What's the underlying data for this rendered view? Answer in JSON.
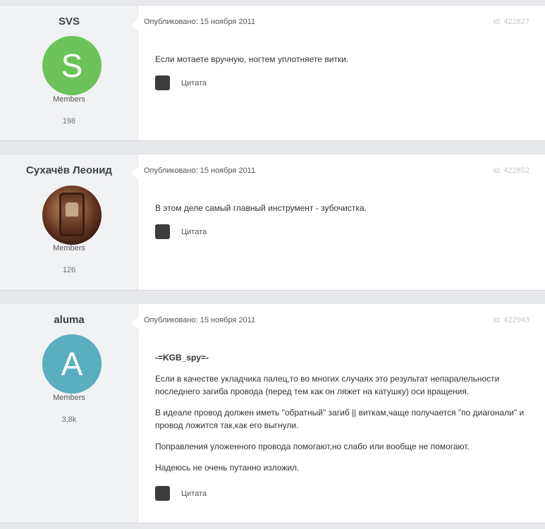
{
  "posts": [
    {
      "author": "SVS",
      "avatar_letter": "S",
      "avatar_color": "#6cc35a",
      "role": "Members",
      "count": "198",
      "published": "Опубликовано: 15 ноября 2011",
      "id_label": "id: 422827",
      "paragraphs": [
        "Если мотаете вручную, ногтем уплотняете витки."
      ],
      "quote_label": "Цитата"
    },
    {
      "author": "Сухачёв Леонид",
      "avatar_letter": "",
      "avatar_color": "#6b3a26",
      "role": "Members",
      "count": "126",
      "published": "Опубликовано: 15 ноября 2011",
      "id_label": "id: 422852",
      "paragraphs": [
        "В этом деле самый главный инструмент - зубочистка."
      ],
      "quote_label": "Цитата"
    },
    {
      "author": "aluma",
      "avatar_letter": "A",
      "avatar_color": "#5aaebf",
      "role": "Members",
      "count": "3,8k",
      "published": "Опубликовано: 15 ноября 2011",
      "id_label": "id: 422943",
      "signature": "-=KGB_spy=-",
      "paragraphs": [
        "Если в качестве укладчика палец,то во многих случаях это результат непаралельности последнего загиба провода (перед тем как он ляжет на катушку) оси вращения.",
        "В идеале провод должен иметь \"обратный\" загиб || виткам,чаще получается \"по диагонали\" и провод ложится так,как его выгнули.",
        "Поправления уложенного провода помогают,но слабо или вообще не помогают.",
        "Надеюсь не очень путанно изложил."
      ],
      "quote_label": "Цитата"
    }
  ]
}
